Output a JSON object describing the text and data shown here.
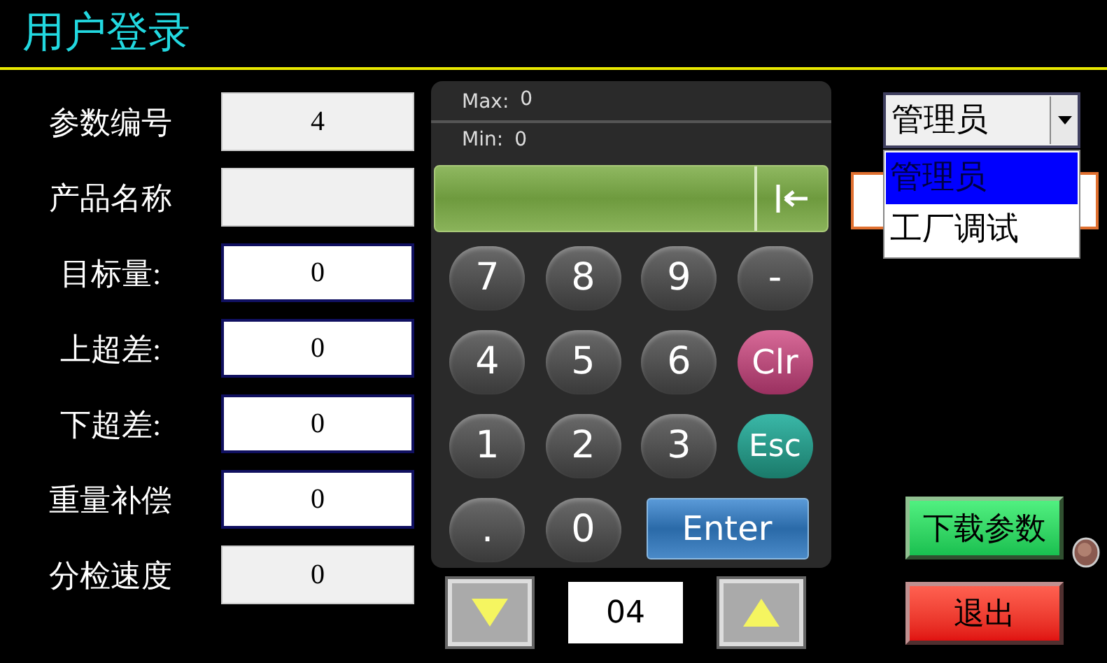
{
  "title": "用户登录",
  "fields": [
    {
      "label": "参数编号",
      "value": "4",
      "kind": "readonly"
    },
    {
      "label": "产品名称",
      "kind": "readonly"
    },
    {
      "label": "目标量:",
      "value": "0",
      "kind": "input"
    },
    {
      "label": "上超差:",
      "value": "0",
      "kind": "input"
    },
    {
      "label": "下超差:",
      "value": "0",
      "kind": "input"
    },
    {
      "label": "重量补偿",
      "value": "0",
      "kind": "input"
    },
    {
      "label": "分检速度",
      "value": "0",
      "kind": "readonly"
    }
  ],
  "keypad": {
    "max_label": "Max:",
    "max": "0",
    "min_label": "Min:",
    "min": "0",
    "keys": [
      {
        "label": "7",
        "kind": "digit"
      },
      {
        "label": "8",
        "kind": "digit"
      },
      {
        "label": "9",
        "kind": "digit"
      },
      {
        "label": "-",
        "kind": "digit"
      },
      {
        "label": "4",
        "kind": "digit"
      },
      {
        "label": "5",
        "kind": "digit"
      },
      {
        "label": "6",
        "kind": "digit"
      },
      {
        "label": "Clr",
        "kind": "clear"
      },
      {
        "label": "1",
        "kind": "digit"
      },
      {
        "label": "2",
        "kind": "digit"
      },
      {
        "label": "3",
        "kind": "digit"
      },
      {
        "label": "Esc",
        "kind": "escape"
      },
      {
        "label": ".",
        "kind": "digit"
      },
      {
        "label": "0",
        "kind": "digit"
      },
      {
        "label": "Enter",
        "kind": "enter"
      }
    ]
  },
  "pager": {
    "value": "04"
  },
  "user_select": {
    "value": "管理员",
    "expanded": true,
    "options": [
      {
        "label": "管理员",
        "selected": true
      },
      {
        "label": "工厂调试",
        "selected": false
      }
    ]
  },
  "buttons": [
    {
      "label": "下载参数",
      "kind": "download"
    },
    {
      "label": "退出",
      "kind": "exit"
    }
  ]
}
